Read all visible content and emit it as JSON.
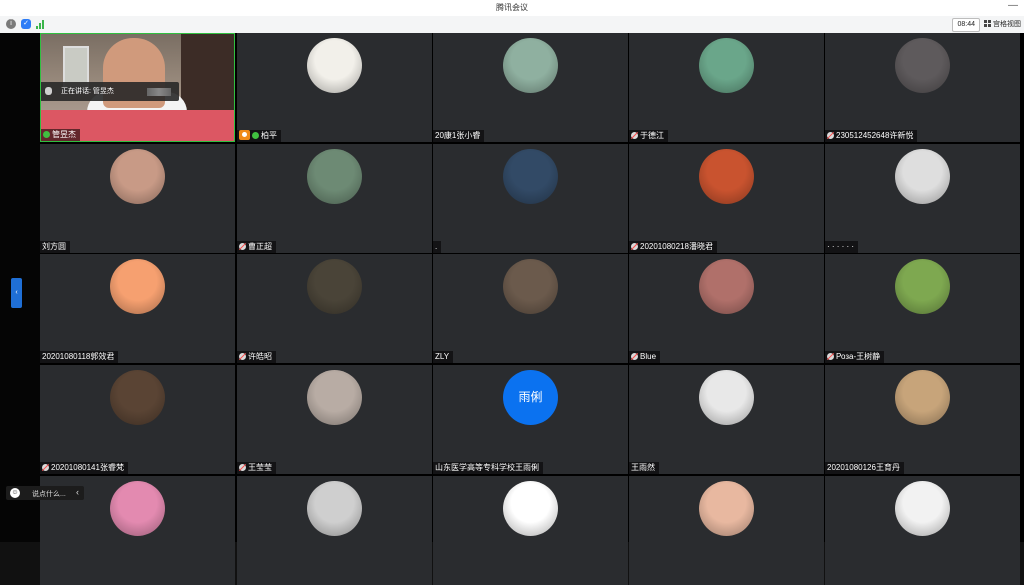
{
  "window": {
    "title": "腾讯会议",
    "minimize": "—"
  },
  "toolbar": {
    "time": "08:44",
    "view_label": "宫格视图"
  },
  "speaking": {
    "text": "正在讲话: 管昱杰"
  },
  "chat": {
    "placeholder": "说点什么...",
    "collapse_glyph": "‹"
  },
  "sidebar": {
    "expand_glyph": "‹"
  },
  "tiles": [
    {
      "name": "管昱杰",
      "mic": "on",
      "video": true
    },
    {
      "name": "柏平",
      "mic": "on",
      "host": true,
      "color": "#f2f0ea"
    },
    {
      "name": "20康1张小睿",
      "mic": "none",
      "color": "#8fb0a0"
    },
    {
      "name": "于德江",
      "mic": "off",
      "color": "#6aa68a"
    },
    {
      "name": "230512452648许新悦",
      "mic": "off",
      "color": "#5e5a5c"
    },
    {
      "name": "刘方圆",
      "mic": "none",
      "color": "#c89a86"
    },
    {
      "name": "曹正超",
      "mic": "off",
      "color": "#6d8a74"
    },
    {
      "name": ".",
      "mic": "none",
      "color": "#324a66"
    },
    {
      "name": "20201080218潘晓君",
      "mic": "off",
      "color": "#c9532f"
    },
    {
      "name": "· · · · · ·",
      "mic": "none",
      "color": "#dedede"
    },
    {
      "name": "20201080118郭效君",
      "mic": "none",
      "color": "#f6a070"
    },
    {
      "name": "许皓昭",
      "mic": "off",
      "color": "#4a4438"
    },
    {
      "name": "ZLY",
      "mic": "none",
      "color": "#6b5a4c"
    },
    {
      "name": "Blue",
      "mic": "off",
      "color": "#b0706a"
    },
    {
      "name": "Роза-王树静",
      "mic": "off",
      "color": "#7ea850"
    },
    {
      "name": "20201080141张睿梵",
      "mic": "off",
      "color": "#5a4434"
    },
    {
      "name": "王莹莹",
      "mic": "off",
      "color": "#b8aca4"
    },
    {
      "name": "山东医学高等专科学校王雨俐",
      "mic": "none",
      "avatar_text": "雨俐",
      "color": "#0b72f0"
    },
    {
      "name": "王雨然",
      "mic": "none",
      "color": "#e8e8e8"
    },
    {
      "name": "20201080126王育丹",
      "mic": "none",
      "color": "#c7a47a"
    },
    {
      "name": "",
      "mic": "none",
      "color": "#e38ab0"
    },
    {
      "name": "",
      "mic": "none",
      "color": "#cfcfcf"
    },
    {
      "name": "",
      "mic": "none",
      "color": "#ffffff"
    },
    {
      "name": "",
      "mic": "none",
      "color": "#e8b8a0"
    },
    {
      "name": "",
      "mic": "none",
      "color": "#f2f2f2"
    }
  ]
}
